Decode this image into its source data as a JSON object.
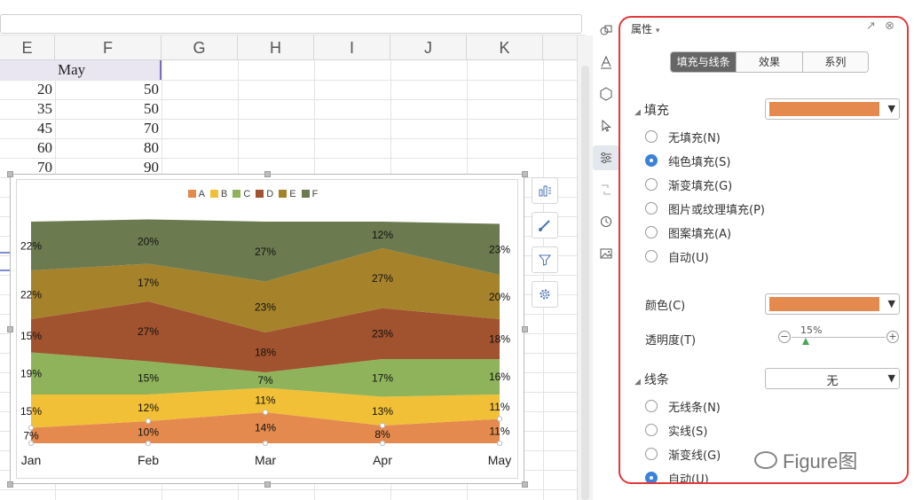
{
  "spreadsheet": {
    "columns": [
      "E",
      "F",
      "G",
      "H",
      "I",
      "J",
      "K"
    ],
    "header_cell": "May",
    "col_e_values": [
      "20",
      "35",
      "45",
      "60",
      "70"
    ],
    "col_f_values": [
      "50",
      "50",
      "70",
      "80",
      "90"
    ]
  },
  "chart_tools": {
    "elements_icon": "chart-elements-icon",
    "style_icon": "brush-icon",
    "filter_icon": "filter-icon",
    "settings_icon": "gear-icon"
  },
  "chart_data": {
    "type": "area",
    "stacked_percent": true,
    "categories": [
      "Jan",
      "Feb",
      "Mar",
      "Apr",
      "May"
    ],
    "series": [
      {
        "name": "A",
        "color": "#e48a4e",
        "values": [
          7,
          10,
          14,
          8,
          11
        ]
      },
      {
        "name": "B",
        "color": "#f2c037",
        "values": [
          15,
          12,
          11,
          13,
          11
        ]
      },
      {
        "name": "C",
        "color": "#8fb35a",
        "values": [
          19,
          15,
          7,
          17,
          16
        ]
      },
      {
        "name": "D",
        "color": "#a1522e",
        "values": [
          15,
          27,
          18,
          23,
          18
        ]
      },
      {
        "name": "E",
        "color": "#a6822b",
        "values": [
          22,
          17,
          23,
          27,
          20
        ]
      },
      {
        "name": "F",
        "color": "#6b7a4f",
        "values": [
          22,
          20,
          27,
          12,
          23
        ]
      }
    ],
    "ylim": [
      0,
      100
    ],
    "legend_position": "top",
    "data_labels": true
  },
  "panel": {
    "title": "属性",
    "tabs": [
      "填充与线条",
      "效果",
      "系列"
    ],
    "active_tab": 0,
    "fill_section": "填充",
    "fill_options": [
      "无填充(N)",
      "纯色填充(S)",
      "渐变填充(G)",
      "图片或纹理填充(P)",
      "图案填充(A)",
      "自动(U)"
    ],
    "fill_selected": 1,
    "color_label": "颜色(C)",
    "fill_color": "#e48a4e",
    "transparency_label": "透明度(T)",
    "transparency_value": "15%",
    "transparency_level": 0.15,
    "line_section": "线条",
    "line_dropdown": "无",
    "line_options": [
      "无线条(N)",
      "实线(S)",
      "渐变线(G)",
      "自动(U)"
    ],
    "line_selected": 3
  },
  "watermark": "Figure图"
}
